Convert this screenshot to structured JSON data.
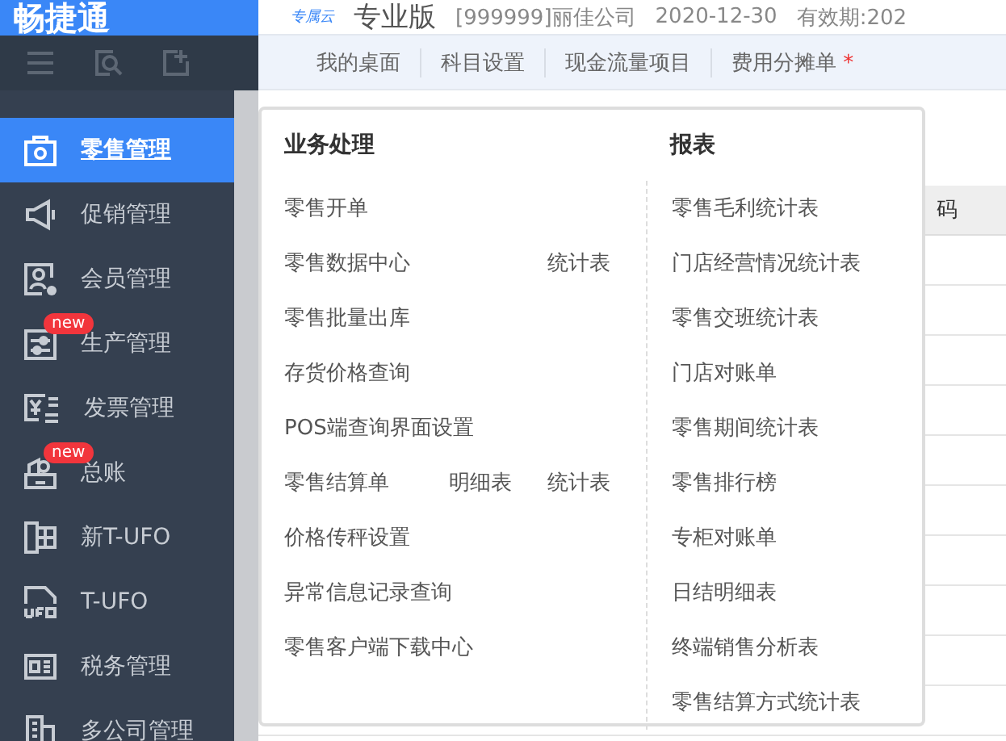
{
  "header": {
    "logo": "畅捷通",
    "badge": "专属云",
    "edition": "专业版",
    "company": "[999999]丽佳公司",
    "date": "2020-12-30",
    "validity": "有效期:202"
  },
  "tabs": [
    {
      "label": "我的桌面"
    },
    {
      "label": "科目设置"
    },
    {
      "label": "现金流量项目"
    },
    {
      "label": "费用分摊单",
      "marker": "*"
    }
  ],
  "sidebar": {
    "items": [
      {
        "label": "零售管理",
        "selected": true
      },
      {
        "label": "促销管理",
        "selected": false
      },
      {
        "label": "会员管理",
        "selected": false
      },
      {
        "label": "生产管理",
        "selected": false,
        "badge": "new"
      },
      {
        "label": "发票管理",
        "selected": false
      },
      {
        "label": "总账",
        "selected": false,
        "badge": "new"
      },
      {
        "label": "新T-UFO",
        "selected": false
      },
      {
        "label": "T-UFO",
        "selected": false
      },
      {
        "label": "税务管理",
        "selected": false
      },
      {
        "label": "多公司管理",
        "selected": false
      }
    ]
  },
  "table": {
    "header": "码"
  },
  "menu": {
    "left": {
      "title": "业务处理",
      "items": [
        {
          "label": "零售开单"
        },
        {
          "label": "零售数据中心",
          "extras": [
            "统计表"
          ]
        },
        {
          "label": "零售批量出库"
        },
        {
          "label": "存货价格查询"
        },
        {
          "label": "POS端查询界面设置"
        },
        {
          "label": "零售结算单",
          "extras": [
            "明细表",
            "统计表"
          ]
        },
        {
          "label": "价格传秤设置"
        },
        {
          "label": "异常信息记录查询"
        },
        {
          "label": "零售客户端下载中心"
        }
      ]
    },
    "right": {
      "title": "报表",
      "items": [
        "零售毛利统计表",
        "门店经营情况统计表",
        "零售交班统计表",
        "门店对账单",
        "零售期间统计表",
        "零售排行榜",
        "专柜对账单",
        "日结明细表",
        "终端销售分析表",
        "零售结算方式统计表"
      ]
    }
  }
}
